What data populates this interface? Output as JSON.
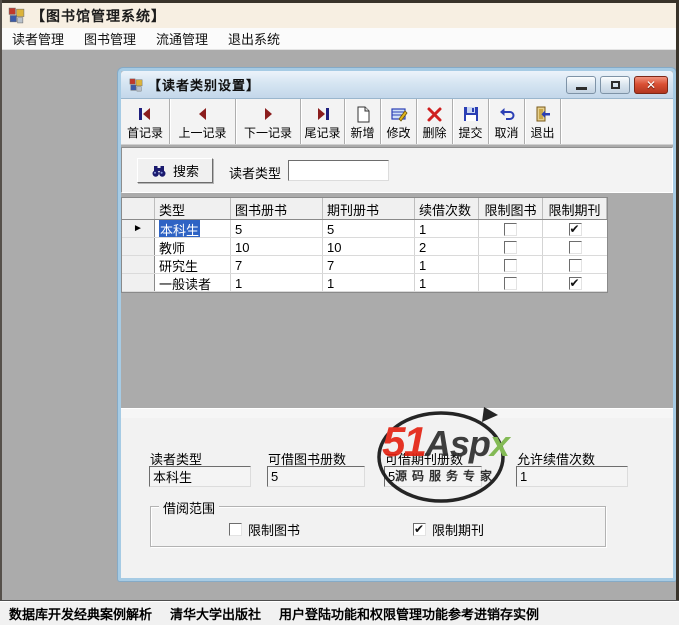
{
  "colors": {
    "title_bar_bg": "#f7efe2",
    "mdi_bg": "#ababab",
    "dialog_border": "#a6cbe4",
    "selection_blue": "#2e63c4",
    "close_button_red": "#da5034",
    "watermark_red": "#e42313",
    "watermark_green": "#7ab648"
  },
  "window": {
    "title": "【图书馆管理系统】",
    "menu": [
      {
        "label": "读者管理"
      },
      {
        "label": "图书管理"
      },
      {
        "label": "流通管理"
      },
      {
        "label": "退出系统"
      }
    ],
    "status": [
      {
        "text": "数据库开发经典案例解析"
      },
      {
        "text": "清华大学出版社"
      },
      {
        "text": "用户登陆功能和权限管理功能参考进销存实例"
      }
    ]
  },
  "dialog": {
    "title": "【读者类别设置】",
    "toolbar": [
      {
        "label": "首记录",
        "icon": "first-record-icon"
      },
      {
        "label": "上一记录",
        "icon": "previous-record-icon"
      },
      {
        "label": "下一记录",
        "icon": "next-record-icon"
      },
      {
        "label": "尾记录",
        "icon": "last-record-icon"
      },
      {
        "label": "新增",
        "icon": "new-document-icon"
      },
      {
        "label": "修改",
        "icon": "edit-icon"
      },
      {
        "label": "删除",
        "icon": "delete-icon"
      },
      {
        "label": "提交",
        "icon": "save-icon"
      },
      {
        "label": "取消",
        "icon": "undo-icon"
      },
      {
        "label": "退出",
        "icon": "exit-icon"
      }
    ],
    "search": {
      "button_label": "搜索",
      "field_label": "读者类型",
      "value": ""
    },
    "grid": {
      "columns": [
        {
          "label": "类型"
        },
        {
          "label": "图书册书"
        },
        {
          "label": "期刊册书"
        },
        {
          "label": "续借次数"
        },
        {
          "label": "限制图书"
        },
        {
          "label": "限制期刊"
        }
      ],
      "rows": [
        {
          "type": "本科生",
          "books": "5",
          "periodicals": "5",
          "renewals": "1",
          "restrict_books": false,
          "restrict_periodicals": true,
          "selected": true
        },
        {
          "type": "教师",
          "books": "10",
          "periodicals": "10",
          "renewals": "2",
          "restrict_books": false,
          "restrict_periodicals": false,
          "selected": false
        },
        {
          "type": "研究生",
          "books": "7",
          "periodicals": "7",
          "renewals": "1",
          "restrict_books": false,
          "restrict_periodicals": false,
          "selected": false
        },
        {
          "type": "一般读者",
          "books": "1",
          "periodicals": "1",
          "renewals": "1",
          "restrict_books": false,
          "restrict_periodicals": true,
          "selected": false
        }
      ]
    },
    "detail": {
      "fields": [
        {
          "label": "读者类型",
          "value": "本科生"
        },
        {
          "label": "可借图书册数",
          "value": "5"
        },
        {
          "label": "可借期刊册数",
          "value": "5"
        },
        {
          "label": "允许续借次数",
          "value": "1"
        }
      ],
      "scope": {
        "title": "借阅范围",
        "options": [
          {
            "label": "限制图书",
            "checked": false
          },
          {
            "label": "限制期刊",
            "checked": true
          }
        ]
      }
    }
  },
  "watermark": {
    "part1": "51",
    "part2": "Asp",
    "part3": "x",
    "subtitle": "源码服务专家"
  }
}
